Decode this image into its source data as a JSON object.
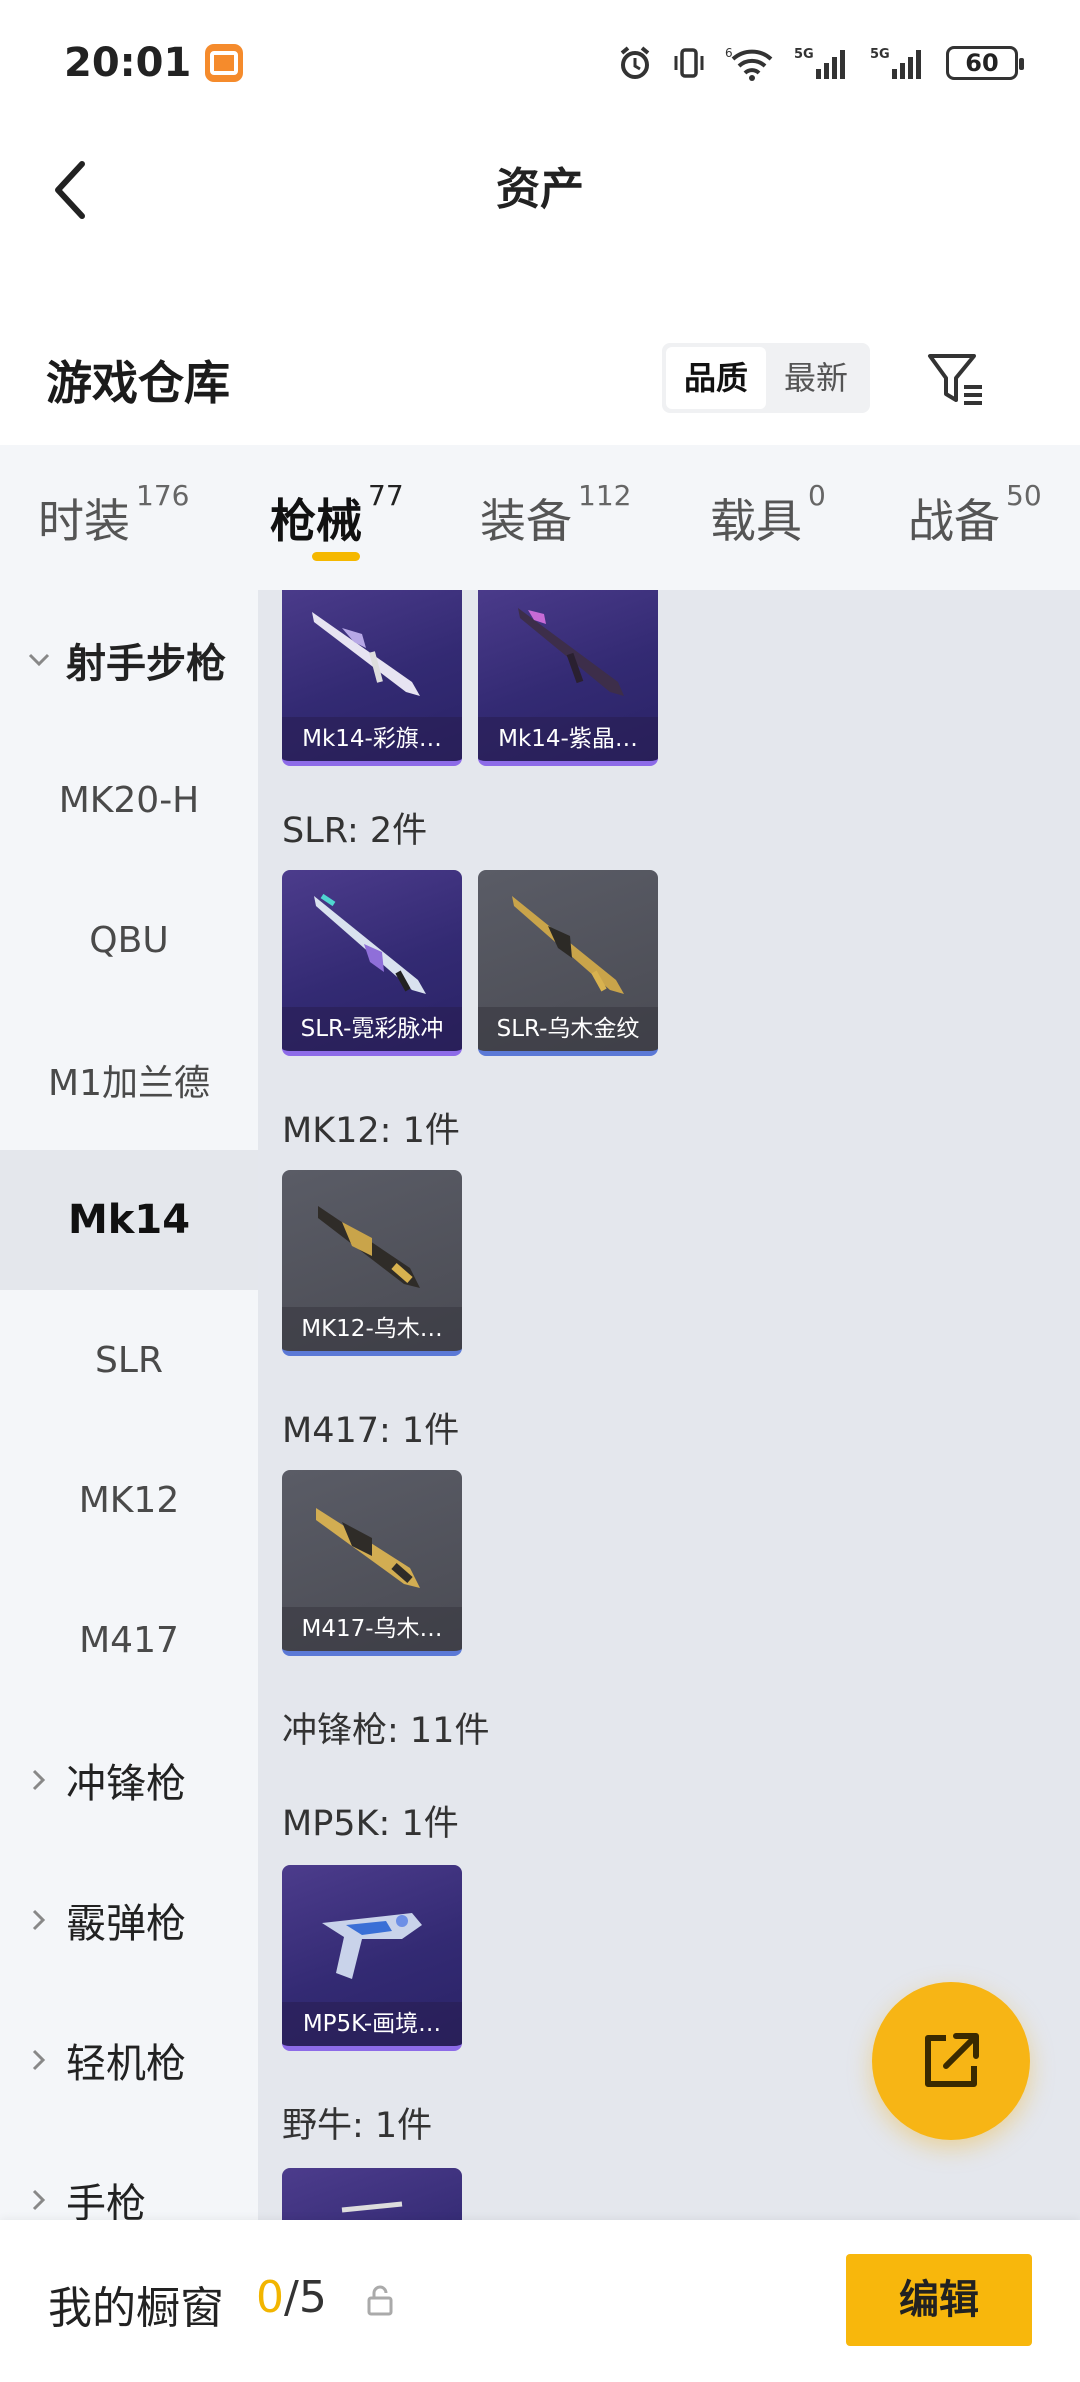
{
  "status_bar": {
    "time": "20:01",
    "battery": "60",
    "net1": "5G",
    "net2": "5G",
    "wifi_sub": "6"
  },
  "header": {
    "title": "资产"
  },
  "warehouse": {
    "title": "游戏仓库",
    "sort_options": [
      {
        "label": "品质",
        "active": true
      },
      {
        "label": "最新",
        "active": false
      }
    ]
  },
  "tabs": [
    {
      "label": "时装",
      "count": "176"
    },
    {
      "label": "枪械",
      "count": "77",
      "active": true
    },
    {
      "label": "装备",
      "count": "112"
    },
    {
      "label": "载具",
      "count": "0"
    },
    {
      "label": "战备",
      "count": "50"
    }
  ],
  "sidebar": {
    "items": [
      {
        "label": "射手步枪",
        "type": "group",
        "expanded": true
      },
      {
        "label": "MK20-H"
      },
      {
        "label": "QBU"
      },
      {
        "label": "M1加兰德"
      },
      {
        "label": "Mk14",
        "active": true
      },
      {
        "label": "SLR"
      },
      {
        "label": "MK12"
      },
      {
        "label": "M417"
      },
      {
        "label": "冲锋枪",
        "type": "group"
      },
      {
        "label": "霰弹枪",
        "type": "group"
      },
      {
        "label": "轻机枪",
        "type": "group"
      },
      {
        "label": "手枪",
        "type": "group"
      }
    ]
  },
  "content": {
    "sections": [
      {
        "label": "SLR: 2件"
      },
      {
        "label": "MK12: 1件"
      },
      {
        "label": "M417: 1件"
      },
      {
        "label": "冲锋枪: 11件"
      },
      {
        "label": "MP5K: 1件"
      },
      {
        "label": "野牛: 1件"
      }
    ],
    "cards": [
      {
        "label": "Mk14-彩旗…",
        "rarity": "purple"
      },
      {
        "label": "Mk14-紫晶…",
        "rarity": "purple"
      },
      {
        "label": "SLR-霓彩脉冲",
        "rarity": "purple"
      },
      {
        "label": "SLR-乌木金纹",
        "rarity": "gray"
      },
      {
        "label": "MK12-乌木…",
        "rarity": "gray"
      },
      {
        "label": "M417-乌木…",
        "rarity": "gray"
      },
      {
        "label": "MP5K-画境…",
        "rarity": "purple"
      },
      {
        "label": "",
        "rarity": "purple"
      }
    ]
  },
  "bottom_bar": {
    "title": "我的橱窗",
    "current": "0",
    "total": "/5",
    "edit_label": "编辑"
  },
  "colors": {
    "accent": "#f7b515",
    "tab_indicator": "#f5b800",
    "purple_card": "#3a2f7c",
    "gray_card": "#52535b"
  },
  "icons": [
    "back-arrow-icon",
    "filter-icon",
    "share-out-icon",
    "lock-icon",
    "chevron-down-icon",
    "chevron-right-icon"
  ]
}
